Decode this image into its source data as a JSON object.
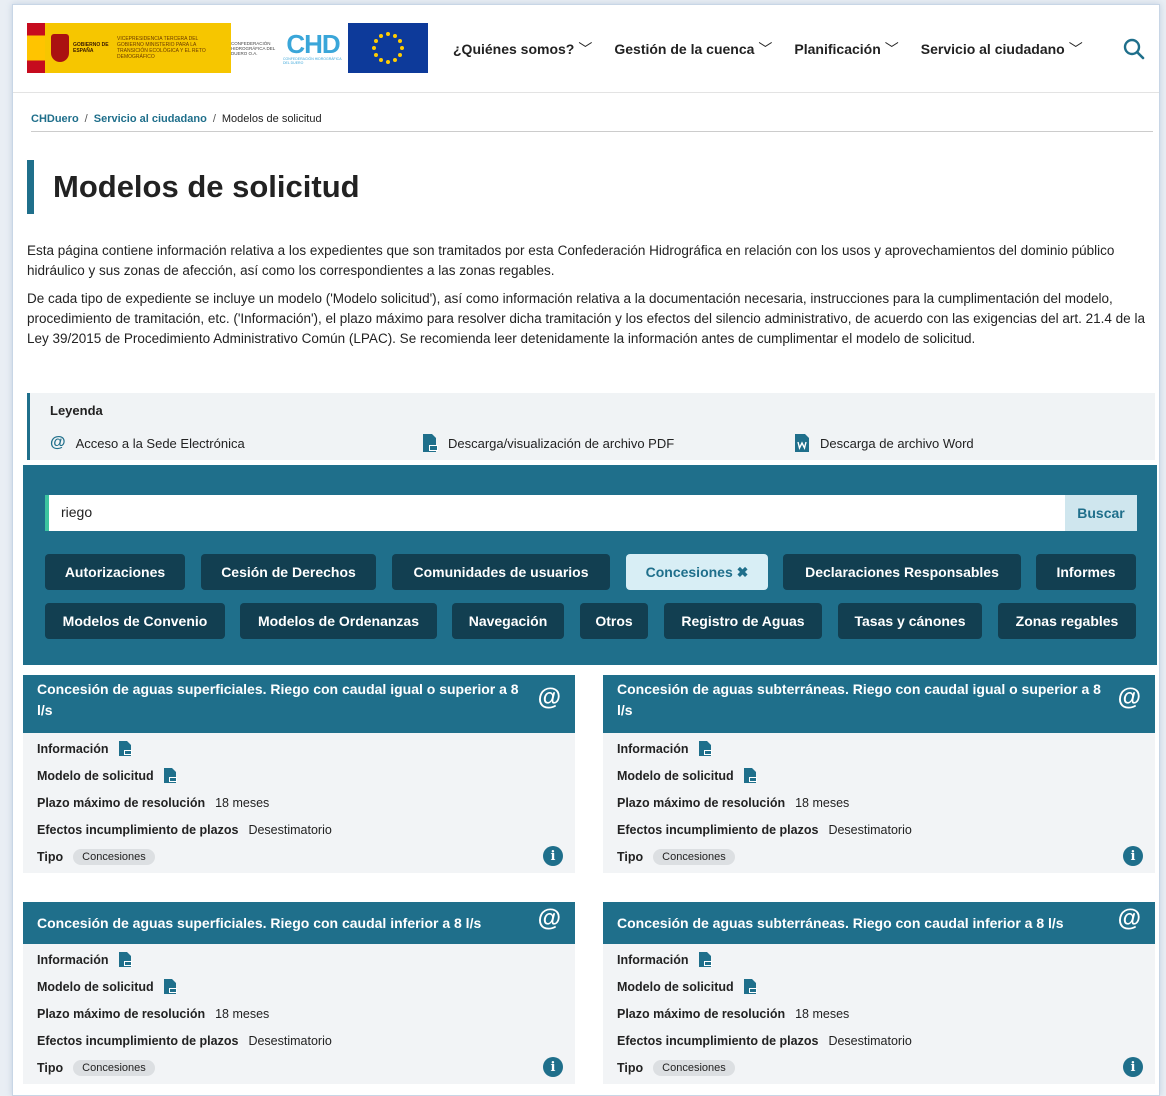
{
  "header": {
    "logo_gob_line1": "GOBIERNO DE ESPAÑA",
    "logo_gob_line2": "VICEPRESIDENCIA TERCERA DEL GOBIERNO MINISTERIO PARA LA TRANSICIÓN ECOLÓGICA Y EL RETO DEMOGRÁFICO",
    "logo_conf": "CONFEDERACIÓN HIDROGRÁFICA DEL DUERO O.A.",
    "logo_chd": "CHD",
    "logo_chd_sub": "CONFEDERACIÓN HIDROGRÁFICA DEL DUERO",
    "nav": [
      "¿Quiénes somos?",
      "Gestión de la cuenca",
      "Planificación",
      "Servicio al ciudadano"
    ]
  },
  "breadcrumb": {
    "home": "CHDuero",
    "section": "Servicio al ciudadano",
    "current": "Modelos de solicitud",
    "sep": "/"
  },
  "page_title": "Modelos de solicitud",
  "intro": {
    "p1": "Esta página contiene información relativa a los expedientes que son tramitados por esta Confederación Hidrográfica en relación con los usos y aprovechamientos del dominio público hidráulico y sus zonas de afección, así como los correspondientes a las zonas regables.",
    "p2": "De cada tipo de expediente se incluye un modelo ('Modelo solicitud'), así como información relativa a la documentación necesaria, instrucciones para la cumplimentación del modelo, procedimiento de tramitación, etc. ('Información'), el plazo máximo para resolver dicha tramitación y los efectos del silencio administrativo, de acuerdo con las exigencias del art. 21.4 de la Ley 39/2015 de Procedimiento Administrativo Común (LPAC). Se recomienda leer detenidamente la información antes de cumplimentar el modelo de solicitud."
  },
  "legend": {
    "title": "Leyenda",
    "sede": "Acceso a la Sede Electrónica",
    "pdf": "Descarga/visualización de archivo PDF",
    "word": "Descarga de archivo Word"
  },
  "search": {
    "value": "riego",
    "button": "Buscar"
  },
  "filters": [
    "Autorizaciones",
    "Cesión de Derechos",
    "Comunidades de usuarios",
    "Concesiones ✖",
    "Declaraciones Responsables",
    "Informes",
    "Modelos de Convenio",
    "Modelos de Ordenanzas",
    "Navegación",
    "Otros",
    "Registro de Aguas",
    "Tasas y cánones",
    "Zonas regables"
  ],
  "labels": {
    "info": "Información",
    "modelo": "Modelo de solicitud",
    "plazo": "Plazo máximo de resolución",
    "efectos": "Efectos incumplimiento de plazos",
    "tipo": "Tipo"
  },
  "cards": [
    {
      "title": "Concesión de aguas superficiales. Riego con caudal igual o superior a 8 l/s",
      "plazo": "18 meses",
      "efectos": "Desestimatorio",
      "tipo": "Concesiones"
    },
    {
      "title": "Concesión de aguas subterráneas. Riego con caudal igual o superior a 8 l/s",
      "plazo": "18 meses",
      "efectos": "Desestimatorio",
      "tipo": "Concesiones"
    },
    {
      "title": "Concesión de aguas superficiales. Riego con caudal inferior a 8 l/s",
      "plazo": "18 meses",
      "efectos": "Desestimatorio",
      "tipo": "Concesiones"
    },
    {
      "title": "Concesión de aguas subterráneas. Riego con caudal inferior a 8 l/s",
      "plazo": "18 meses",
      "efectos": "Desestimatorio",
      "tipo": "Concesiones"
    }
  ],
  "colors": {
    "primary": "#1f6f8b",
    "chip": "#123f51",
    "chip_active": "#d8eef5",
    "search_accent": "#3cc4a0"
  },
  "icons": {
    "sede": "at-icon",
    "pdf": "pdf-icon",
    "word": "word-icon",
    "info": "info-icon",
    "search": "search-icon"
  }
}
